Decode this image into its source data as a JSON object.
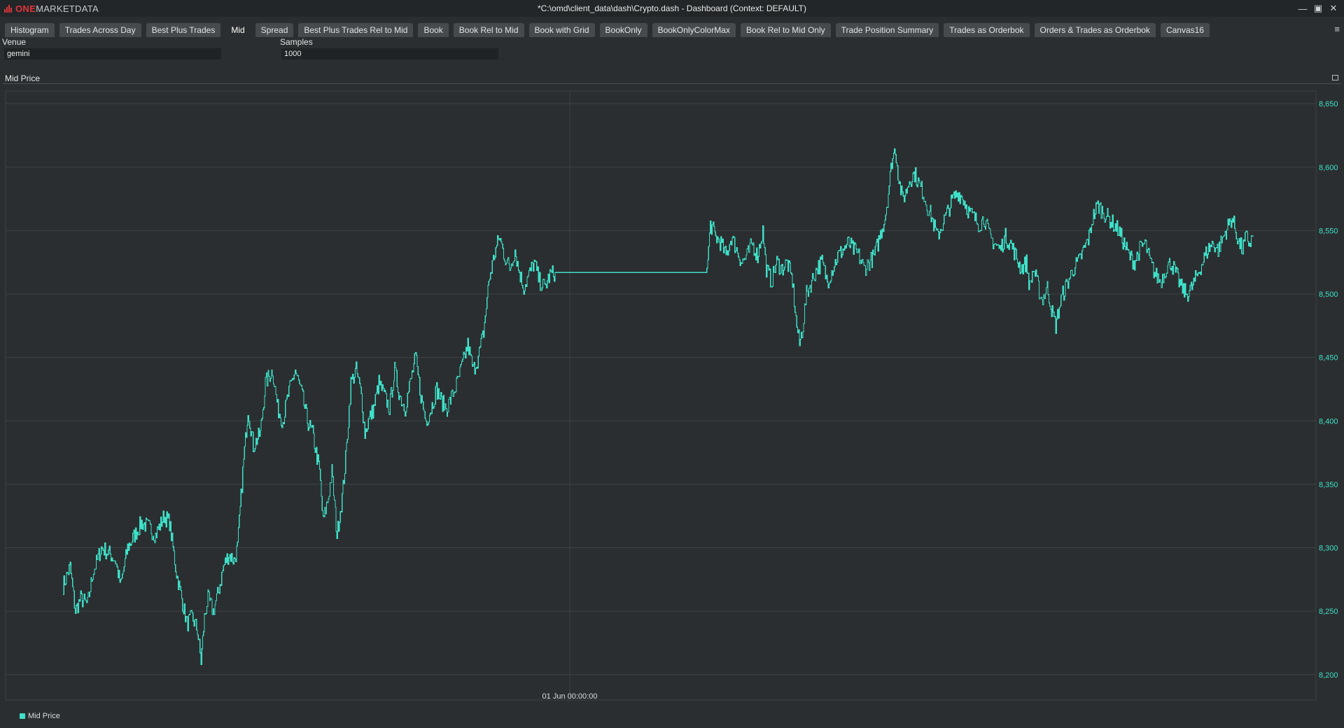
{
  "app": {
    "logo_one": "ONE",
    "logo_rest": "MARKETDATA",
    "window_title": "*C:\\omd\\client_data\\dash\\Crypto.dash - Dashboard (Context: DEFAULT)",
    "controls": [
      "—",
      "▣",
      "✕"
    ]
  },
  "tabs": [
    {
      "label": "Histogram"
    },
    {
      "label": "Trades Across Day"
    },
    {
      "label": "Best Plus Trades"
    },
    {
      "label": "Mid",
      "active": true
    },
    {
      "label": "Spread"
    },
    {
      "label": "Best Plus Trades Rel to Mid"
    },
    {
      "label": "Book"
    },
    {
      "label": "Book Rel to Mid"
    },
    {
      "label": "Book with Grid"
    },
    {
      "label": "BookOnly"
    },
    {
      "label": "BookOnlyColorMax"
    },
    {
      "label": "Book Rel to Mid Only"
    },
    {
      "label": "Trade Position Summary"
    },
    {
      "label": "Trades as Orderbok"
    },
    {
      "label": "Orders & Trades as Orderbok"
    },
    {
      "label": "Canvas16"
    }
  ],
  "tab_menu_icon": "≡",
  "params": {
    "venue_label": "Venue",
    "venue_value": "gemini",
    "samples_label": "Samples",
    "samples_value": "1000"
  },
  "panel": {
    "title": "Mid Price"
  },
  "chart_data": {
    "type": "line",
    "series": [
      {
        "name": "Mid Price",
        "color": "#3ee0c8",
        "anchors": [
          [
            0,
            8270
          ],
          [
            8,
            8285
          ],
          [
            14,
            8250
          ],
          [
            20,
            8260
          ],
          [
            28,
            8255
          ],
          [
            34,
            8280
          ],
          [
            44,
            8300
          ],
          [
            54,
            8295
          ],
          [
            60,
            8290
          ],
          [
            66,
            8270
          ],
          [
            74,
            8300
          ],
          [
            82,
            8310
          ],
          [
            90,
            8320
          ],
          [
            100,
            8315
          ],
          [
            106,
            8310
          ],
          [
            116,
            8325
          ],
          [
            122,
            8320
          ],
          [
            126,
            8300
          ],
          [
            130,
            8280
          ],
          [
            136,
            8260
          ],
          [
            142,
            8240
          ],
          [
            148,
            8245
          ],
          [
            154,
            8235
          ],
          [
            158,
            8210
          ],
          [
            162,
            8245
          ],
          [
            166,
            8260
          ],
          [
            172,
            8250
          ],
          [
            178,
            8265
          ],
          [
            184,
            8285
          ],
          [
            190,
            8295
          ],
          [
            196,
            8290
          ],
          [
            200,
            8300
          ],
          [
            206,
            8360
          ],
          [
            212,
            8410
          ],
          [
            218,
            8380
          ],
          [
            226,
            8390
          ],
          [
            232,
            8430
          ],
          [
            240,
            8440
          ],
          [
            246,
            8410
          ],
          [
            252,
            8400
          ],
          [
            258,
            8420
          ],
          [
            266,
            8440
          ],
          [
            274,
            8420
          ],
          [
            280,
            8400
          ],
          [
            286,
            8390
          ],
          [
            294,
            8360
          ],
          [
            298,
            8320
          ],
          [
            304,
            8340
          ],
          [
            308,
            8360
          ],
          [
            314,
            8310
          ],
          [
            320,
            8340
          ],
          [
            324,
            8370
          ],
          [
            330,
            8430
          ],
          [
            336,
            8440
          ],
          [
            342,
            8420
          ],
          [
            346,
            8390
          ],
          [
            350,
            8400
          ],
          [
            356,
            8410
          ],
          [
            362,
            8430
          ],
          [
            368,
            8420
          ],
          [
            374,
            8410
          ],
          [
            380,
            8440
          ],
          [
            386,
            8420
          ],
          [
            392,
            8410
          ],
          [
            398,
            8430
          ],
          [
            404,
            8450
          ],
          [
            410,
            8420
          ],
          [
            416,
            8400
          ],
          [
            422,
            8410
          ],
          [
            428,
            8425
          ],
          [
            434,
            8415
          ],
          [
            440,
            8410
          ],
          [
            446,
            8420
          ],
          [
            452,
            8430
          ],
          [
            458,
            8445
          ],
          [
            464,
            8460
          ],
          [
            470,
            8440
          ],
          [
            476,
            8450
          ],
          [
            482,
            8470
          ],
          [
            488,
            8510
          ],
          [
            494,
            8530
          ],
          [
            500,
            8545
          ],
          [
            506,
            8530
          ],
          [
            512,
            8520
          ],
          [
            518,
            8535
          ],
          [
            522,
            8520
          ],
          [
            528,
            8505
          ],
          [
            534,
            8515
          ],
          [
            540,
            8525
          ],
          [
            546,
            8510
          ],
          [
            552,
            8505
          ],
          [
            558,
            8515
          ],
          [
            564,
            8517
          ],
          [
            606,
            8517
          ],
          [
            620,
            8517
          ],
          [
            655,
            8517
          ],
          [
            710,
            8517
          ],
          [
            725,
            8517
          ],
          [
            738,
            8517
          ],
          [
            742,
            8555
          ],
          [
            748,
            8545
          ],
          [
            754,
            8540
          ],
          [
            760,
            8530
          ],
          [
            766,
            8545
          ],
          [
            772,
            8535
          ],
          [
            778,
            8525
          ],
          [
            784,
            8530
          ],
          [
            790,
            8540
          ],
          [
            796,
            8530
          ],
          [
            802,
            8550
          ],
          [
            806,
            8520
          ],
          [
            812,
            8510
          ],
          [
            818,
            8525
          ],
          [
            824,
            8520
          ],
          [
            830,
            8525
          ],
          [
            836,
            8510
          ],
          [
            840,
            8480
          ],
          [
            844,
            8460
          ],
          [
            848,
            8475
          ],
          [
            852,
            8500
          ],
          [
            858,
            8510
          ],
          [
            864,
            8520
          ],
          [
            870,
            8525
          ],
          [
            876,
            8510
          ],
          [
            882,
            8520
          ],
          [
            888,
            8530
          ],
          [
            894,
            8535
          ],
          [
            900,
            8540
          ],
          [
            906,
            8535
          ],
          [
            912,
            8530
          ],
          [
            918,
            8520
          ],
          [
            924,
            8525
          ],
          [
            930,
            8530
          ],
          [
            936,
            8545
          ],
          [
            942,
            8560
          ],
          [
            946,
            8580
          ],
          [
            950,
            8605
          ],
          [
            954,
            8615
          ],
          [
            958,
            8590
          ],
          [
            962,
            8575
          ],
          [
            966,
            8580
          ],
          [
            970,
            8590
          ],
          [
            976,
            8595
          ],
          [
            982,
            8585
          ],
          [
            986,
            8580
          ],
          [
            990,
            8570
          ],
          [
            996,
            8560
          ],
          [
            1002,
            8545
          ],
          [
            1008,
            8555
          ],
          [
            1014,
            8565
          ],
          [
            1020,
            8575
          ],
          [
            1026,
            8580
          ],
          [
            1032,
            8575
          ],
          [
            1038,
            8565
          ],
          [
            1044,
            8560
          ],
          [
            1050,
            8555
          ],
          [
            1056,
            8560
          ],
          [
            1062,
            8545
          ],
          [
            1068,
            8540
          ],
          [
            1074,
            8535
          ],
          [
            1080,
            8545
          ],
          [
            1086,
            8540
          ],
          [
            1092,
            8530
          ],
          [
            1098,
            8520
          ],
          [
            1104,
            8525
          ],
          [
            1108,
            8505
          ],
          [
            1112,
            8520
          ],
          [
            1116,
            8510
          ],
          [
            1122,
            8495
          ],
          [
            1128,
            8505
          ],
          [
            1134,
            8485
          ],
          [
            1138,
            8475
          ],
          [
            1142,
            8490
          ],
          [
            1146,
            8500
          ],
          [
            1152,
            8510
          ],
          [
            1158,
            8520
          ],
          [
            1164,
            8525
          ],
          [
            1170,
            8535
          ],
          [
            1176,
            8545
          ],
          [
            1180,
            8560
          ],
          [
            1186,
            8570
          ],
          [
            1192,
            8565
          ],
          [
            1198,
            8560
          ],
          [
            1204,
            8555
          ],
          [
            1210,
            8550
          ],
          [
            1216,
            8540
          ],
          [
            1222,
            8530
          ],
          [
            1228,
            8525
          ],
          [
            1234,
            8535
          ],
          [
            1240,
            8540
          ],
          [
            1246,
            8525
          ],
          [
            1252,
            8515
          ],
          [
            1258,
            8510
          ],
          [
            1264,
            8520
          ],
          [
            1270,
            8525
          ],
          [
            1276,
            8515
          ],
          [
            1282,
            8505
          ],
          [
            1288,
            8500
          ],
          [
            1294,
            8505
          ],
          [
            1300,
            8515
          ],
          [
            1306,
            8525
          ],
          [
            1312,
            8535
          ],
          [
            1318,
            8540
          ],
          [
            1324,
            8535
          ],
          [
            1330,
            8545
          ],
          [
            1336,
            8555
          ],
          [
            1340,
            8560
          ],
          [
            1344,
            8550
          ],
          [
            1348,
            8540
          ],
          [
            1352,
            8535
          ],
          [
            1356,
            8545
          ],
          [
            1360,
            8540
          ],
          [
            1364,
            8545
          ]
        ]
      }
    ],
    "ylim": [
      8180,
      8660
    ],
    "y_ticks": [
      "8,650",
      "8,600",
      "8,550",
      "8,500",
      "8,450",
      "8,400",
      "8,350",
      "8,300",
      "8,250",
      "8,200"
    ],
    "x_ticks": [
      "01 Jun 00:00:00"
    ],
    "grid": true,
    "legend_position": "bottom-left",
    "legend": [
      "Mid Price"
    ]
  }
}
